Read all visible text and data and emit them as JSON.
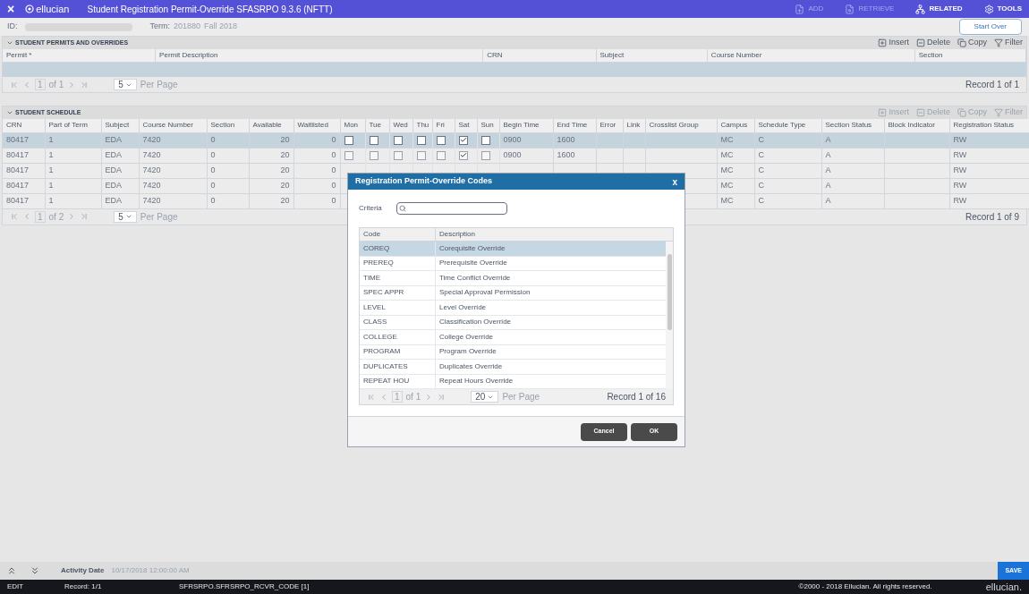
{
  "header": {
    "close": "×",
    "brand": "ellucian",
    "title": "Student Registration Permit-Override SFASRPO 9.3.6 (NFTT)",
    "actions": [
      {
        "label": "ADD",
        "kind": "add",
        "disabled": true
      },
      {
        "label": "RETRIEVE",
        "kind": "retrieve",
        "disabled": true
      },
      {
        "label": "RELATED",
        "kind": "related",
        "disabled": false
      },
      {
        "label": "TOOLS",
        "kind": "tools",
        "disabled": false
      }
    ]
  },
  "key_block": {
    "id_label": "ID:",
    "term_label": "Term:",
    "term_code": "201880",
    "term_name": "Fall 2018",
    "start_over": "Start Over"
  },
  "permits": {
    "title": "STUDENT PERMITS AND OVERRIDES",
    "tools": [
      {
        "label": "Insert",
        "kind": "insert",
        "disabled": false
      },
      {
        "label": "Delete",
        "kind": "delete",
        "disabled": false
      },
      {
        "label": "Copy",
        "kind": "copy",
        "disabled": false
      },
      {
        "label": "Filter",
        "kind": "filter",
        "disabled": false
      }
    ],
    "columns": [
      "Permit *",
      "Permit Description",
      "CRN",
      "Subject",
      "Course Number",
      "Section"
    ],
    "pager": {
      "page": "1",
      "of": "of 1",
      "per_page": "5",
      "per_page_label": "Per Page",
      "record": "Record 1 of 1"
    }
  },
  "schedule": {
    "title": "STUDENT SCHEDULE",
    "tools": [
      {
        "label": "Insert",
        "kind": "insert",
        "disabled": true
      },
      {
        "label": "Delete",
        "kind": "delete",
        "disabled": true
      },
      {
        "label": "Copy",
        "kind": "copy",
        "disabled": true
      },
      {
        "label": "Filter",
        "kind": "filter",
        "disabled": true
      }
    ],
    "columns": [
      "CRN",
      "Part of Term",
      "Subject",
      "Course Number",
      "Section",
      "Available",
      "Waitlisted",
      "Mon",
      "Tue",
      "Wed",
      "Thu",
      "Fri",
      "Sat",
      "Sun",
      "Begin Time",
      "End Time",
      "Error",
      "Link",
      "Crosslist Group",
      "Campus",
      "Schedule Type",
      "Section Status",
      "Block Indicator",
      "Registration Status"
    ],
    "rows": [
      {
        "selected": true,
        "crn": "80417",
        "part_of_term": "1",
        "subject": "EDA",
        "course_number": "7420",
        "section": "0",
        "available": "20",
        "waitlisted": "0",
        "days": [
          {
            "checked": false
          },
          {
            "checked": false
          },
          {
            "checked": false
          },
          {
            "checked": false
          },
          {
            "checked": false
          },
          {
            "checked": true
          },
          {
            "checked": false
          }
        ],
        "begin_time": "0900",
        "end_time": "1600",
        "campus": "MC",
        "schedule_type": "C",
        "section_status": "A",
        "registration_status": "RW"
      },
      {
        "selected": false,
        "crn": "80417",
        "part_of_term": "1",
        "subject": "EDA",
        "course_number": "7420",
        "section": "0",
        "available": "20",
        "waitlisted": "0",
        "days": [
          {
            "checked": false
          },
          {
            "checked": false
          },
          {
            "checked": false
          },
          {
            "checked": false
          },
          {
            "checked": false
          },
          {
            "checked": true
          },
          {
            "checked": false
          }
        ],
        "begin_time": "0900",
        "end_time": "1600",
        "campus": "MC",
        "schedule_type": "C",
        "section_status": "A",
        "registration_status": "RW"
      },
      {
        "selected": false,
        "crn": "80417",
        "part_of_term": "1",
        "subject": "EDA",
        "course_number": "7420",
        "section": "0",
        "available": "20",
        "waitlisted": "0",
        "campus": "MC",
        "schedule_type": "C",
        "section_status": "A",
        "registration_status": "RW"
      },
      {
        "selected": false,
        "crn": "80417",
        "part_of_term": "1",
        "subject": "EDA",
        "course_number": "7420",
        "section": "0",
        "available": "20",
        "waitlisted": "0",
        "campus": "MC",
        "schedule_type": "C",
        "section_status": "A",
        "registration_status": "RW"
      },
      {
        "selected": false,
        "crn": "80417",
        "part_of_term": "1",
        "subject": "EDA",
        "course_number": "7420",
        "section": "0",
        "available": "20",
        "waitlisted": "0",
        "campus": "MC",
        "schedule_type": "C",
        "section_status": "A",
        "registration_status": "RW"
      }
    ],
    "pager": {
      "page": "1",
      "of": "of 2",
      "per_page": "5",
      "per_page_label": "Per Page",
      "record": "Record 1 of 9"
    }
  },
  "dialog": {
    "title": "Registration Permit-Override Codes",
    "close": "x",
    "criteria_label": "Criteria",
    "columns": [
      "Code",
      "Description"
    ],
    "rows": [
      {
        "selected": true,
        "code": "COREQ",
        "description": "Corequisite Override"
      },
      {
        "selected": false,
        "code": "PREREQ",
        "description": "Prerequisite Override"
      },
      {
        "selected": false,
        "code": "TIME",
        "description": "Time Conflict Override"
      },
      {
        "selected": false,
        "code": "SPEC APPR",
        "description": "Special Approval Permission"
      },
      {
        "selected": false,
        "code": "LEVEL",
        "description": "Level Override"
      },
      {
        "selected": false,
        "code": "CLASS",
        "description": "Classification Override"
      },
      {
        "selected": false,
        "code": "COLLEGE",
        "description": "College Override"
      },
      {
        "selected": false,
        "code": "PROGRAM",
        "description": "Program Override"
      },
      {
        "selected": false,
        "code": "DUPLICATES",
        "description": "Duplicates Override"
      },
      {
        "selected": false,
        "code": "REPEAT HOU",
        "description": "Repeat Hours Override"
      }
    ],
    "pager": {
      "page": "1",
      "of": "of 1",
      "per_page": "20",
      "per_page_label": "Per Page",
      "record": "Record 1 of 16"
    },
    "buttons": [
      "Cancel",
      "OK"
    ]
  },
  "footer": {
    "activity_label": "Activity Date",
    "activity_value": "10/17/2018 12:00:00 AM",
    "save": "SAVE"
  },
  "status_bar": {
    "mode": "EDIT",
    "record": "Record: 1/1",
    "field": "SFRSRPO.SFRSRPO_RCVR_CODE [1]",
    "copyright": "©2000 - 2018 Ellucian. All rights reserved.",
    "logo": "ellucian."
  }
}
